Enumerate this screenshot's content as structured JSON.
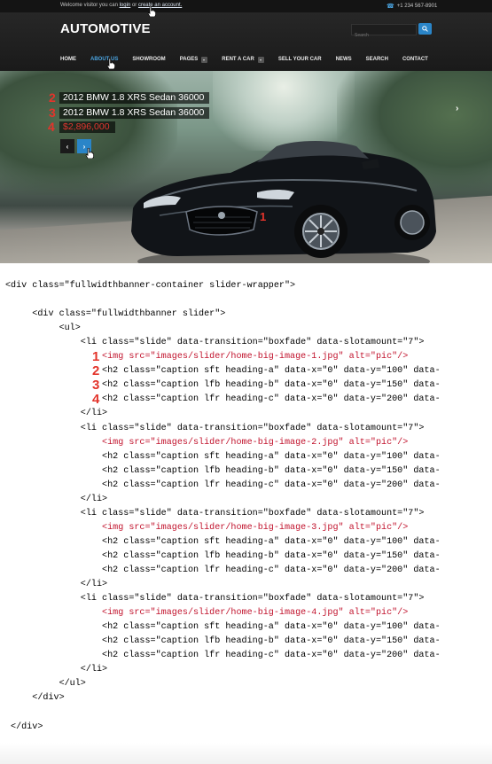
{
  "header": {
    "welcome_text": "Welcome visitor you can ",
    "login_link": "login",
    "or_text": " or ",
    "create_account_link": "create an account.",
    "phone": "+1 234 567-8901",
    "phone_icon": "phone-icon",
    "logo": "AUTOMOTIVE",
    "search_placeholder": "Search",
    "search_icon": "search-icon",
    "nav": [
      {
        "label": "HOME",
        "active": false
      },
      {
        "label": "ABOUT US",
        "active": true
      },
      {
        "label": "SHOWROOM",
        "active": false
      },
      {
        "label": "PAGES",
        "active": false,
        "dropdown": true
      },
      {
        "label": "RENT A CAR",
        "active": false,
        "dropdown": true
      },
      {
        "label": "SELL YOUR CAR",
        "active": false
      },
      {
        "label": "NEWS",
        "active": false
      },
      {
        "label": "SEARCH",
        "active": false
      },
      {
        "label": "CONTACT",
        "active": false
      }
    ]
  },
  "slider": {
    "caption_a": "2012 BMW 1.8 XRS Sedan 36000",
    "caption_b": "2012 BMW 1.8 XRS Sedan 36000",
    "caption_c": "$2,896,000",
    "markers": [
      "1",
      "2",
      "3",
      "4"
    ],
    "prev_icon": "chevron-left-icon",
    "next_icon": "chevron-right-icon",
    "prev_glyph": "‹",
    "next_glyph": "›",
    "edge_next_glyph": "›",
    "accent_color": "#2a85c8",
    "price_color": "#e0362f"
  },
  "code": {
    "lines": [
      "<div class=\"fullwidthbanner-container slider-wrapper\">",
      "",
      "     <div class=\"fullwidthbanner slider\">",
      "          <ul>",
      "              <li class=\"slide\" data-transition=\"boxfade\" data-slotamount=\"7\">",
      "                  <img src=\"images/slider/home-big-image-1.jpg\" alt=\"pic\"/>",
      "                  <h2 class=\"caption sft heading-a\" data-x=\"0\" data-y=\"100\" data-",
      "                  <h2 class=\"caption lfb heading-b\" data-x=\"0\" data-y=\"150\" data-",
      "                  <h2 class=\"caption lfr heading-c\" data-x=\"0\" data-y=\"200\" data-",
      "              </li>",
      "              <li class=\"slide\" data-transition=\"boxfade\" data-slotamount=\"7\">",
      "                  <img src=\"images/slider/home-big-image-2.jpg\" alt=\"pic\"/>",
      "                  <h2 class=\"caption sft heading-a\" data-x=\"0\" data-y=\"100\" data-",
      "                  <h2 class=\"caption lfb heading-b\" data-x=\"0\" data-y=\"150\" data-",
      "                  <h2 class=\"caption lfr heading-c\" data-x=\"0\" data-y=\"200\" data-",
      "              </li>",
      "              <li class=\"slide\" data-transition=\"boxfade\" data-slotamount=\"7\">",
      "                  <img src=\"images/slider/home-big-image-3.jpg\" alt=\"pic\"/>",
      "                  <h2 class=\"caption sft heading-a\" data-x=\"0\" data-y=\"100\" data-",
      "                  <h2 class=\"caption lfb heading-b\" data-x=\"0\" data-y=\"150\" data-",
      "                  <h2 class=\"caption lfr heading-c\" data-x=\"0\" data-y=\"200\" data-",
      "              </li>",
      "              <li class=\"slide\" data-transition=\"boxfade\" data-slotamount=\"7\">",
      "                  <img src=\"images/slider/home-big-image-4.jpg\" alt=\"pic\"/>",
      "                  <h2 class=\"caption sft heading-a\" data-x=\"0\" data-y=\"100\" data-",
      "                  <h2 class=\"caption lfb heading-b\" data-x=\"0\" data-y=\"150\" data-",
      "                  <h2 class=\"caption lfr heading-c\" data-x=\"0\" data-y=\"200\" data-",
      "              </li>",
      "          </ul>",
      "     </div>",
      "",
      " </div>"
    ],
    "img_line_indices": [
      5,
      11,
      17,
      23
    ],
    "markers": [
      "1",
      "2",
      "3",
      "4"
    ],
    "img_color": "#c1122c"
  }
}
